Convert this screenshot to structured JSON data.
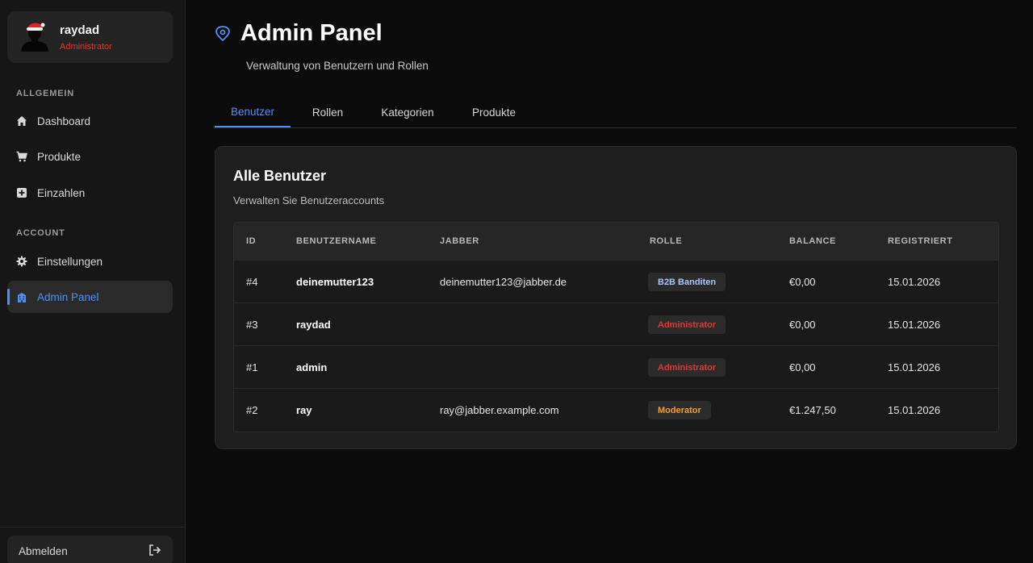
{
  "sidebar": {
    "user": {
      "name": "raydad",
      "role": "Administrator"
    },
    "sections": [
      {
        "label": "ALLGEMEIN"
      },
      {
        "label": "ACCOUNT"
      }
    ],
    "items": [
      {
        "label": "Dashboard",
        "icon": "home-icon"
      },
      {
        "label": "Produkte",
        "icon": "cart-icon"
      },
      {
        "label": "Einzahlen",
        "icon": "plus-square-icon"
      },
      {
        "label": "Einstellungen",
        "icon": "gear-icon"
      },
      {
        "label": "Admin Panel",
        "icon": "building-icon",
        "active": true
      }
    ],
    "logout_label": "Abmelden"
  },
  "header": {
    "title": "Admin Panel",
    "subtitle": "Verwaltung von Benutzern und Rollen"
  },
  "tabs": [
    {
      "label": "Benutzer",
      "active": true
    },
    {
      "label": "Rollen"
    },
    {
      "label": "Kategorien"
    },
    {
      "label": "Produkte"
    }
  ],
  "card": {
    "title": "Alle Benutzer",
    "subtitle": "Verwalten Sie Benutzeraccounts",
    "columns": [
      "ID",
      "BENUTZERNAME",
      "JABBER",
      "ROLLE",
      "BALANCE",
      "REGISTRIERT"
    ],
    "rows": [
      {
        "id": "#4",
        "username": "deinemutter123",
        "jabber": "deinemutter123@jabber.de",
        "role": "B2B Banditen",
        "role_color": "#a9c4ff",
        "balance": "€0,00",
        "registered": "15.01.2026"
      },
      {
        "id": "#3",
        "username": "raydad",
        "jabber": "",
        "role": "Administrator",
        "role_color": "#e0392f",
        "balance": "€0,00",
        "registered": "15.01.2026"
      },
      {
        "id": "#1",
        "username": "admin",
        "jabber": "",
        "role": "Administrator",
        "role_color": "#e0392f",
        "balance": "€0,00",
        "registered": "15.01.2026"
      },
      {
        "id": "#2",
        "username": "ray",
        "jabber": "ray@jabber.example.com",
        "role": "Moderator",
        "role_color": "#f0a032",
        "balance": "€1.247,50",
        "registered": "15.01.2026"
      }
    ]
  },
  "colors": {
    "accent": "#4f8ff7",
    "danger": "#e0392f",
    "warning": "#f0a032"
  }
}
